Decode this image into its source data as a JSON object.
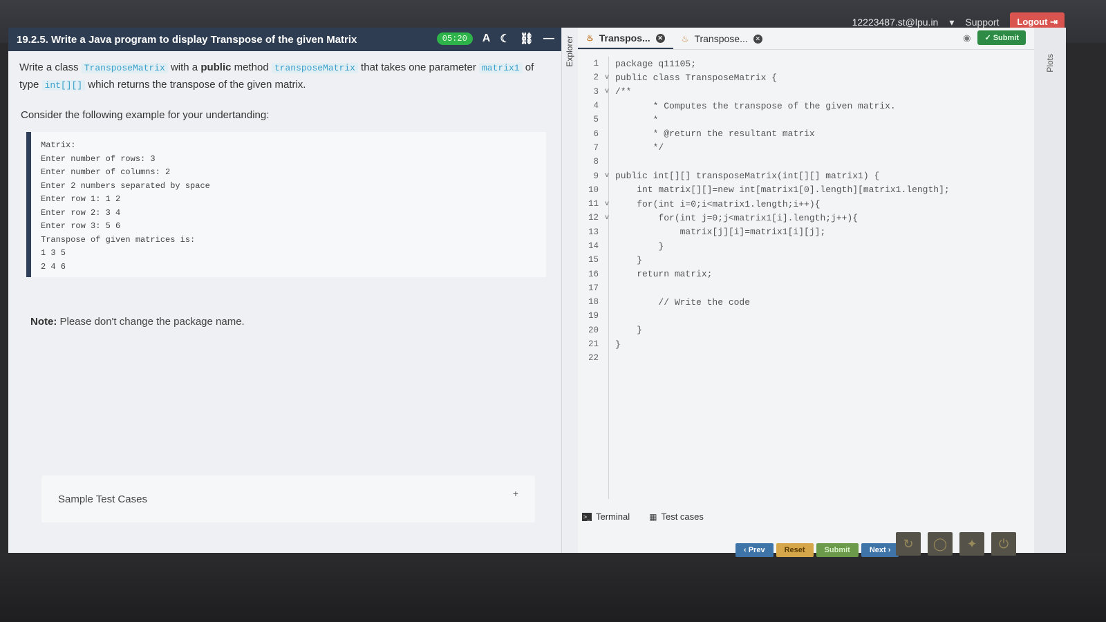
{
  "topbar": {
    "user_email": "12223487.st@lpu.in",
    "support_label": "Support",
    "logout_label": "Logout"
  },
  "question": {
    "title": "19.2.5. Write a Java program to display Transpose of the given Matrix",
    "timer": "05:20",
    "desc_part1": "Write a class ",
    "class_name": "TransposeMatrix",
    "desc_part2": " with a ",
    "desc_public": "public",
    "desc_part3": " method ",
    "method_name": "transposeMatrix",
    "desc_part4": " that takes one parameter ",
    "param_name": "matrix1",
    "desc_part5": " of type ",
    "param_type": "int[][]",
    "desc_part6": " which returns the transpose of the given matrix.",
    "consider": "Consider the following example for your undertanding:",
    "example": "Matrix:\nEnter number of rows: 3\nEnter number of columns: 2\nEnter 2 numbers separated by space\nEnter row 1: 1 2\nEnter row 2: 3 4\nEnter row 3: 5 6\nTranspose of given matrices is:\n1 3 5\n2 4 6",
    "note_label": "Note:",
    "note_text": " Please don't change the package name.",
    "sample_tests_label": "Sample Test Cases",
    "sample_tests_icon": "+"
  },
  "explorer": {
    "label": "Explorer"
  },
  "editor": {
    "tabs": [
      {
        "label": "Transpos...",
        "active": true
      },
      {
        "label": "Transpose...",
        "active": false
      }
    ],
    "submit_label": "Submit",
    "lines": [
      {
        "n": "1",
        "fold": "",
        "text": "package q11105;"
      },
      {
        "n": "2",
        "fold": "v",
        "text": "public class TransposeMatrix {"
      },
      {
        "n": "3",
        "fold": "v",
        "text": "/**"
      },
      {
        "n": "4",
        "fold": "",
        "text": "       * Computes the transpose of the given matrix."
      },
      {
        "n": "5",
        "fold": "",
        "text": "       *"
      },
      {
        "n": "6",
        "fold": "",
        "text": "       * @return the resultant matrix"
      },
      {
        "n": "7",
        "fold": "",
        "text": "       */"
      },
      {
        "n": "8",
        "fold": "",
        "text": ""
      },
      {
        "n": "9",
        "fold": "v",
        "text": "public int[][] transposeMatrix(int[][] matrix1) {"
      },
      {
        "n": "10",
        "fold": "",
        "text": "    int matrix[][]=new int[matrix1[0].length][matrix1.length];"
      },
      {
        "n": "11",
        "fold": "v",
        "text": "    for(int i=0;i<matrix1.length;i++){"
      },
      {
        "n": "12",
        "fold": "v",
        "text": "        for(int j=0;j<matrix1[i].length;j++){"
      },
      {
        "n": "13",
        "fold": "",
        "text": "            matrix[j][i]=matrix1[i][j];"
      },
      {
        "n": "14",
        "fold": "",
        "text": "        }"
      },
      {
        "n": "15",
        "fold": "",
        "text": "    }"
      },
      {
        "n": "16",
        "fold": "",
        "text": "    return matrix;"
      },
      {
        "n": "17",
        "fold": "",
        "text": ""
      },
      {
        "n": "18",
        "fold": "",
        "text": "        // Write the code"
      },
      {
        "n": "19",
        "fold": "",
        "text": ""
      },
      {
        "n": "20",
        "fold": "",
        "text": "    }"
      },
      {
        "n": "21",
        "fold": "",
        "text": "}"
      },
      {
        "n": "22",
        "fold": "",
        "text": ""
      }
    ],
    "terminal_label": "Terminal",
    "testcases_label": "Test cases"
  },
  "plots": {
    "label": "Plots"
  },
  "nav": {
    "prev_label": "‹ Prev",
    "reset_label": "Reset",
    "submit_label": "Submit",
    "next_label": "Next ›"
  }
}
